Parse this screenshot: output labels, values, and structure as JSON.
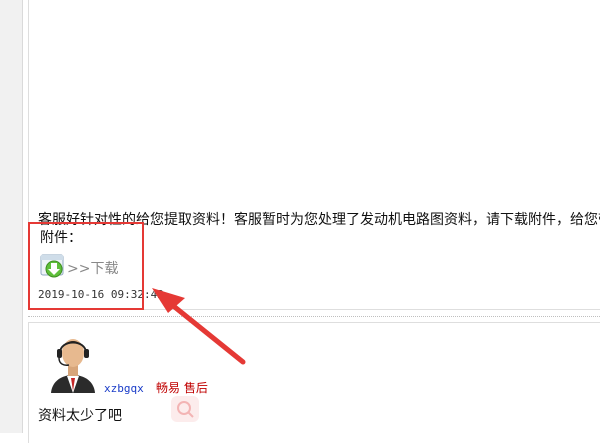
{
  "post": {
    "message": "客服好针对性的给您提取资料！客服暂时为您处理了发动机电路图资料，请下载附件，给您带",
    "attachment_label": "附件：",
    "download_label": ">>下载",
    "timestamp": "2019-10-16 09:32:42"
  },
  "reply": {
    "username": "xzbgqx",
    "team_label": "畅易 售后",
    "text": "资料太少了吧"
  },
  "icons": {
    "download": "download-arrow-icon",
    "avatar": "support-agent-avatar",
    "faint": "search-icon"
  },
  "colors": {
    "highlight": "#e53935",
    "username": "#1a3cc8",
    "team_label": "#c00000",
    "download_link": "#888888"
  }
}
